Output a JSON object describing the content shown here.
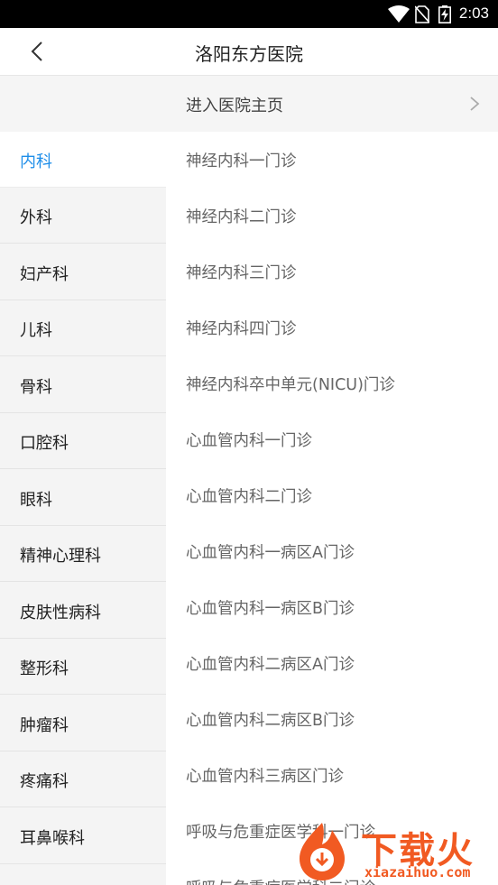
{
  "status_bar": {
    "time": "2:03",
    "icons": [
      "wifi-icon",
      "no-sim-icon",
      "battery-charging-icon"
    ]
  },
  "header": {
    "title": "洛阳东方医院",
    "back_icon": "back-arrow-icon"
  },
  "home_link": {
    "label": "进入医院主页",
    "icon": "chevron-right-icon"
  },
  "departments": [
    {
      "label": "内科",
      "active": true
    },
    {
      "label": "外科"
    },
    {
      "label": "妇产科"
    },
    {
      "label": "儿科"
    },
    {
      "label": "骨科"
    },
    {
      "label": "口腔科"
    },
    {
      "label": "眼科"
    },
    {
      "label": "精神心理科"
    },
    {
      "label": "皮肤性病科"
    },
    {
      "label": "整形科"
    },
    {
      "label": "肿瘤科"
    },
    {
      "label": "疼痛科"
    },
    {
      "label": "耳鼻喉科"
    }
  ],
  "clinics": [
    {
      "label": "神经内科一门诊"
    },
    {
      "label": "神经内科二门诊"
    },
    {
      "label": "神经内科三门诊"
    },
    {
      "label": "神经内科四门诊"
    },
    {
      "label": "神经内科卒中单元(NICU)门诊"
    },
    {
      "label": "心血管内科一门诊"
    },
    {
      "label": "心血管内科二门诊"
    },
    {
      "label": "心血管内科一病区A门诊"
    },
    {
      "label": "心血管内科一病区B门诊"
    },
    {
      "label": "心血管内科二病区A门诊"
    },
    {
      "label": "心血管内科二病区B门诊"
    },
    {
      "label": "心血管内科三病区门诊"
    },
    {
      "label": "呼吸与危重症医学科一门诊"
    },
    {
      "label": "呼吸与危重症医学科二门诊"
    }
  ],
  "watermark": {
    "text": "下载火",
    "url": "xiazaihuo.com"
  },
  "colors": {
    "accent": "#1e8ee9",
    "sidebar_bg": "#f4f4f4",
    "watermark": "#f15a22"
  }
}
